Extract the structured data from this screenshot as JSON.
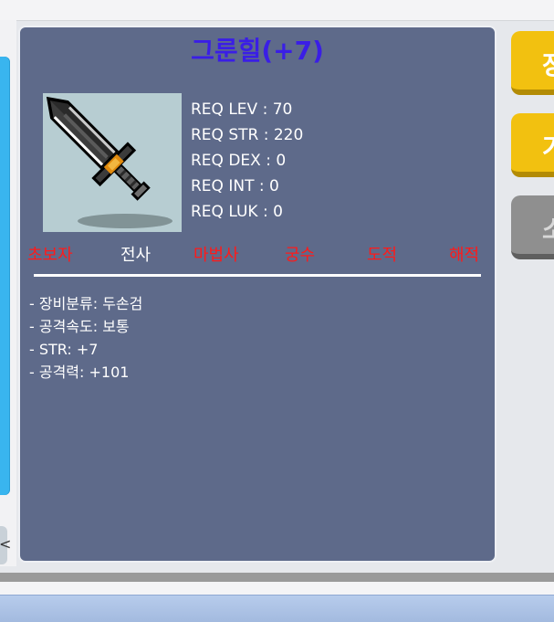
{
  "item": {
    "title": "그룬힐(+7)",
    "image_icon": "two-handed-sword-icon"
  },
  "requirements": [
    "REQ LEV : 70",
    "REQ STR : 220",
    "REQ DEX : 0",
    "REQ INT : 0",
    "REQ LUK : 0"
  ],
  "jobs": [
    {
      "label": "초보자",
      "color": "#ff1a1a"
    },
    {
      "label": "전사",
      "color": "#ffffff"
    },
    {
      "label": "마법사",
      "color": "#ff1a1a"
    },
    {
      "label": "궁수",
      "color": "#ff1a1a"
    },
    {
      "label": "도적",
      "color": "#ff1a1a"
    },
    {
      "label": "해적",
      "color": "#ff1a1a"
    }
  ],
  "stats": [
    "- 장비분류: 두손검",
    "- 공격속도: 보통",
    "- STR: +7",
    "- 공격력: +101"
  ],
  "side_buttons": [
    {
      "label": "장",
      "style": "yellow"
    },
    {
      "label": "가",
      "style": "yellow"
    },
    {
      "label": "소",
      "style": "gray"
    }
  ],
  "left_stub_glyph": "<",
  "colors": {
    "card_bg": "#5e6a8a",
    "title": "#3a1ee6",
    "available_job": "#ffffff",
    "unavailable_job": "#ff1a1a",
    "button_yellow": "#f2c110",
    "button_gray": "#8f8f8f",
    "side_blue": "#39b5ef"
  }
}
